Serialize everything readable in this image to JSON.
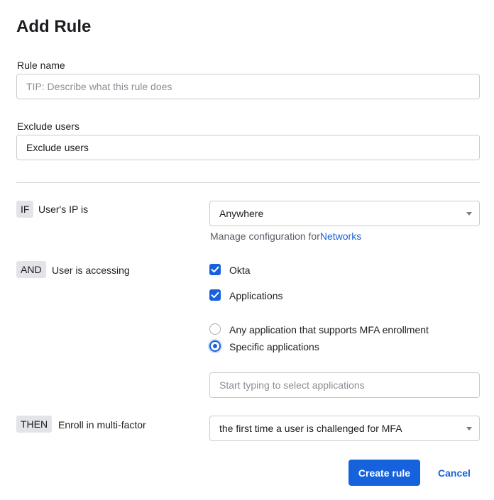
{
  "dialog": {
    "title": "Add Rule"
  },
  "rule_name": {
    "label": "Rule name",
    "placeholder": "TIP: Describe what this rule does",
    "value": ""
  },
  "exclude_users": {
    "label": "Exclude users",
    "value": "Exclude users"
  },
  "if_row": {
    "tag": "IF",
    "label": "User's IP is",
    "select_value": "Anywhere",
    "manage_text": "Manage configuration for",
    "manage_link": "Networks"
  },
  "and_row": {
    "tag": "AND",
    "label": "User is accessing",
    "checkboxes": [
      {
        "label": "Okta",
        "checked": true
      },
      {
        "label": "Applications",
        "checked": true
      }
    ],
    "radios": [
      {
        "label": "Any application that supports MFA enrollment",
        "selected": false
      },
      {
        "label": "Specific applications",
        "selected": true
      }
    ],
    "app_search_placeholder": "Start typing to select applications"
  },
  "then_row": {
    "tag": "THEN",
    "label": "Enroll in multi-factor",
    "select_value": "the first time a user is challenged for MFA"
  },
  "footer": {
    "create_label": "Create rule",
    "cancel_label": "Cancel"
  },
  "colors": {
    "accent": "#1662dd",
    "tag_bg": "#e3e4e7",
    "border": "#c9cbd0"
  }
}
